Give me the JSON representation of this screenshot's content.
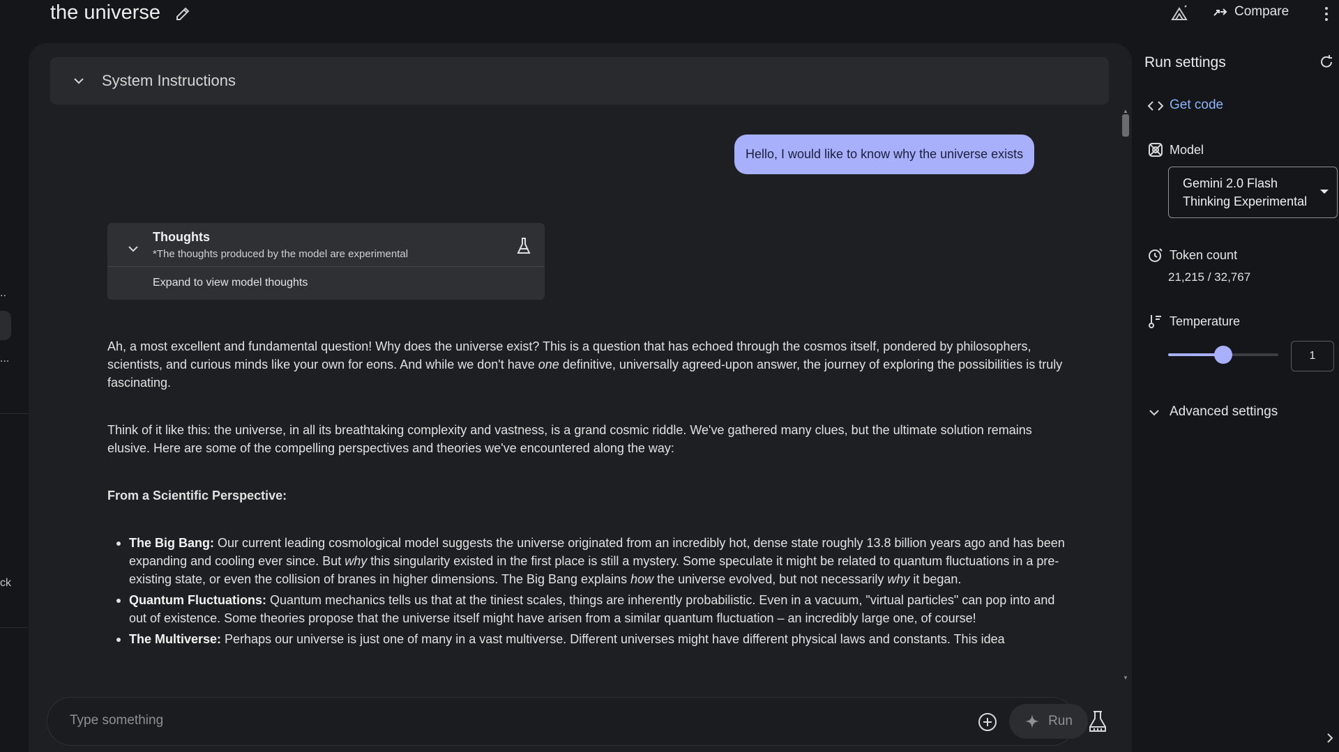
{
  "colors": {
    "accent": "#a8b0fc",
    "link": "#8ab4f8",
    "panel": "#1e1f22",
    "background": "#151619"
  },
  "leftnav": {
    "fragments": [
      "..",
      "...",
      "ck"
    ]
  },
  "header": {
    "title": "the universe",
    "compare_label": "Compare",
    "icons": [
      "edit-icon",
      "data-icon",
      "compare-icon",
      "more-vert-icon"
    ]
  },
  "system_instructions": {
    "label": "System Instructions"
  },
  "chat": {
    "user_message": "Hello, I would like to know why the universe exists",
    "thoughts": {
      "title": "Thoughts",
      "subtitle": "*The thoughts produced by the model are experimental",
      "expand_label": "Expand to view model thoughts"
    },
    "response": {
      "p1_a": "Ah, a most excellent and fundamental question! Why does the universe exist? This is a question that has echoed through the cosmos itself, pondered by philosophers, scientists, and curious minds like your own for eons. And while we don't have ",
      "p1_em": "one",
      "p1_b": " definitive, universally agreed-upon answer, the journey of exploring the possibilities is truly fascinating.",
      "p2": "Think of it like this: the universe, in all its breathtaking complexity and vastness, is a grand cosmic riddle. We've gathered many clues, but the ultimate solution remains elusive. Here are some of the compelling perspectives and theories we've encountered along the way:",
      "heading": "From a Scientific Perspective:",
      "bullets": [
        {
          "term": "The Big Bang:",
          "a": " Our current leading cosmological model suggests the universe originated from an incredibly hot, dense state roughly 13.8 billion years ago and has been expanding and cooling ever since. But ",
          "em1": "why",
          "b": " this singularity existed in the first place is still a mystery. Some speculate it might be related to quantum fluctuations in a pre-existing state, or even the collision of branes in higher dimensions. The Big Bang explains ",
          "em2": "how",
          "c": " the universe evolved, but not necessarily ",
          "em3": "why",
          "d": " it began."
        },
        {
          "term": "Quantum Fluctuations:",
          "text": " Quantum mechanics tells us that at the tiniest scales, things are inherently probabilistic. Even in a vacuum, \"virtual particles\" can pop into and out of existence. Some theories propose that the universe itself might have arisen from a similar quantum fluctuation – an incredibly large one, of course!"
        },
        {
          "term": "The Multiverse:",
          "text": " Perhaps our universe is just one of many in a vast multiverse. Different universes might have different physical laws and constants. This idea"
        }
      ]
    }
  },
  "composer": {
    "placeholder": "Type something",
    "run_label": "Run"
  },
  "settings": {
    "title": "Run settings",
    "get_code": "Get code",
    "model_label": "Model",
    "model_value_line1": "Gemini 2.0 Flash",
    "model_value_line2": "Thinking Experimental",
    "token_label": "Token count",
    "token_value": "21,215 / 32,767",
    "temperature_label": "Temperature",
    "temperature_value": "1",
    "temperature_slider_fraction": 0.5,
    "advanced_label": "Advanced settings"
  }
}
